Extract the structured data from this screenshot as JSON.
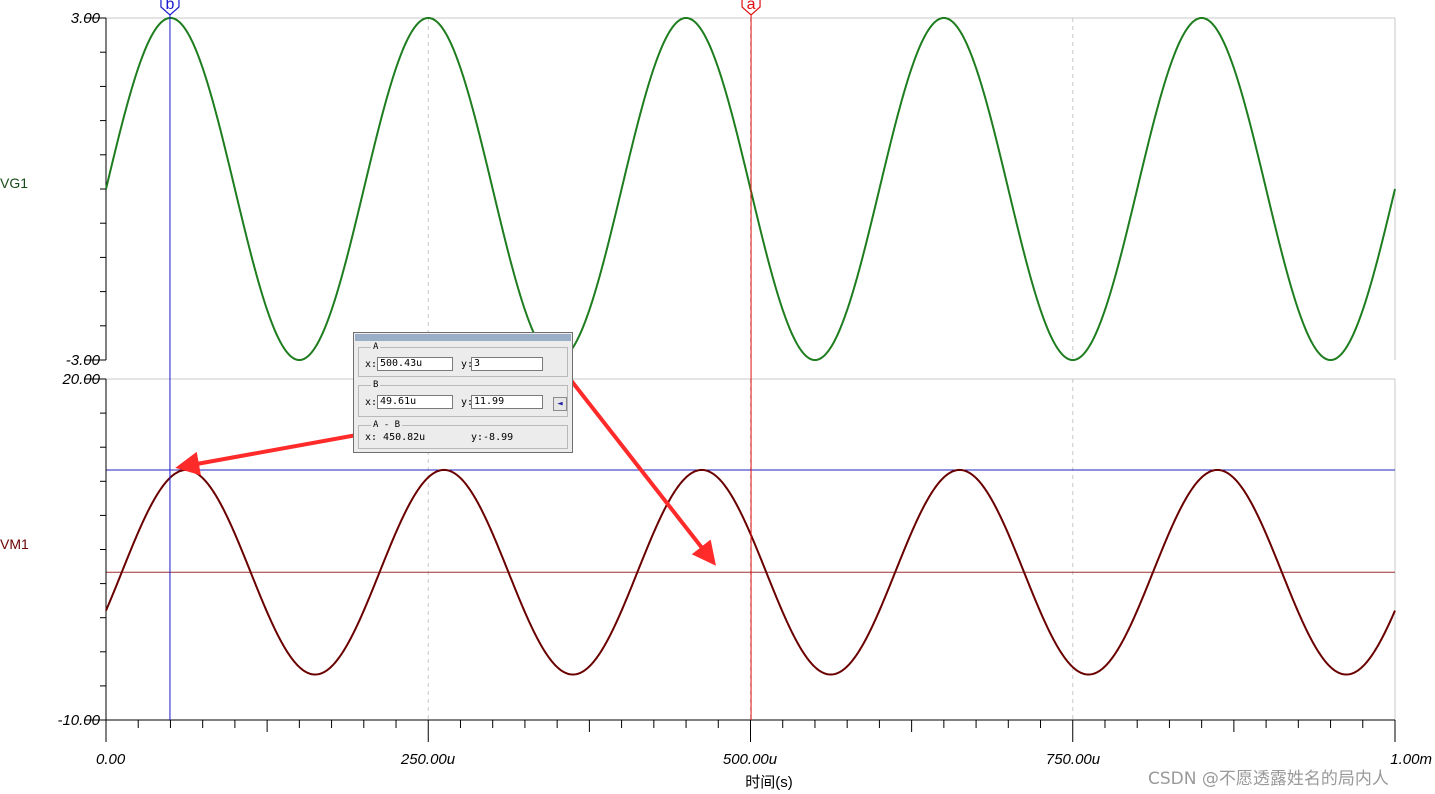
{
  "chart_data": [
    {
      "type": "line",
      "title": "",
      "signal": "VG1",
      "ylim": [
        -3.0,
        3.0
      ],
      "y_tick_labels": [
        "3.00",
        "-3.00"
      ],
      "xlim": [
        0,
        0.001
      ],
      "waveform": {
        "kind": "sine",
        "amplitude": 3.0,
        "offset": 0.0,
        "frequency_hz": 5000,
        "phase_deg": 0
      },
      "color": "#1e7d1e",
      "grid": true
    },
    {
      "type": "line",
      "title": "",
      "signal": "VM1",
      "ylim": [
        -10.0,
        20.0
      ],
      "y_tick_labels": [
        "20.00",
        "-10.00"
      ],
      "xlim": [
        0,
        0.001
      ],
      "waveform": {
        "kind": "sine",
        "amplitude": 9.0,
        "offset": 3.0,
        "frequency_hz": 5000,
        "phase_deg": -22
      },
      "color": "#6b0000",
      "grid": true,
      "reference_lines": [
        {
          "y": 11.99,
          "color": "#2020c0"
        },
        {
          "y": 3.0,
          "color": "#a03030"
        }
      ]
    }
  ],
  "x_axis": {
    "label": "时间(s)",
    "tick_labels": [
      "0.00",
      "250.00u",
      "500.00u",
      "750.00u",
      "1.00m"
    ],
    "tick_values": [
      0,
      0.00025,
      0.0005,
      0.00075,
      0.001
    ]
  },
  "cursors": {
    "a": {
      "tag": "a",
      "x": 0.00050043,
      "color": "#e01010"
    },
    "b": {
      "tag": "b",
      "x": 4.961e-05,
      "color": "#1a1ad0"
    }
  },
  "dialog": {
    "group_a": "A",
    "group_b": "B",
    "group_diff": "A - B",
    "x_label": "x:",
    "y_label": "y:",
    "a_x": "500.43u",
    "a_y": "3",
    "b_x": "49.61u",
    "b_y": "11.99",
    "diff_x": "x: 450.82u",
    "diff_y": "y:-8.99",
    "arrow_glyph": "◄"
  },
  "watermark": "CSDN @不愿透露姓名的局内人",
  "colors": {
    "annotation_red": "#ff2a2a",
    "axis": "#000000",
    "grid": "#c8c8c8"
  }
}
